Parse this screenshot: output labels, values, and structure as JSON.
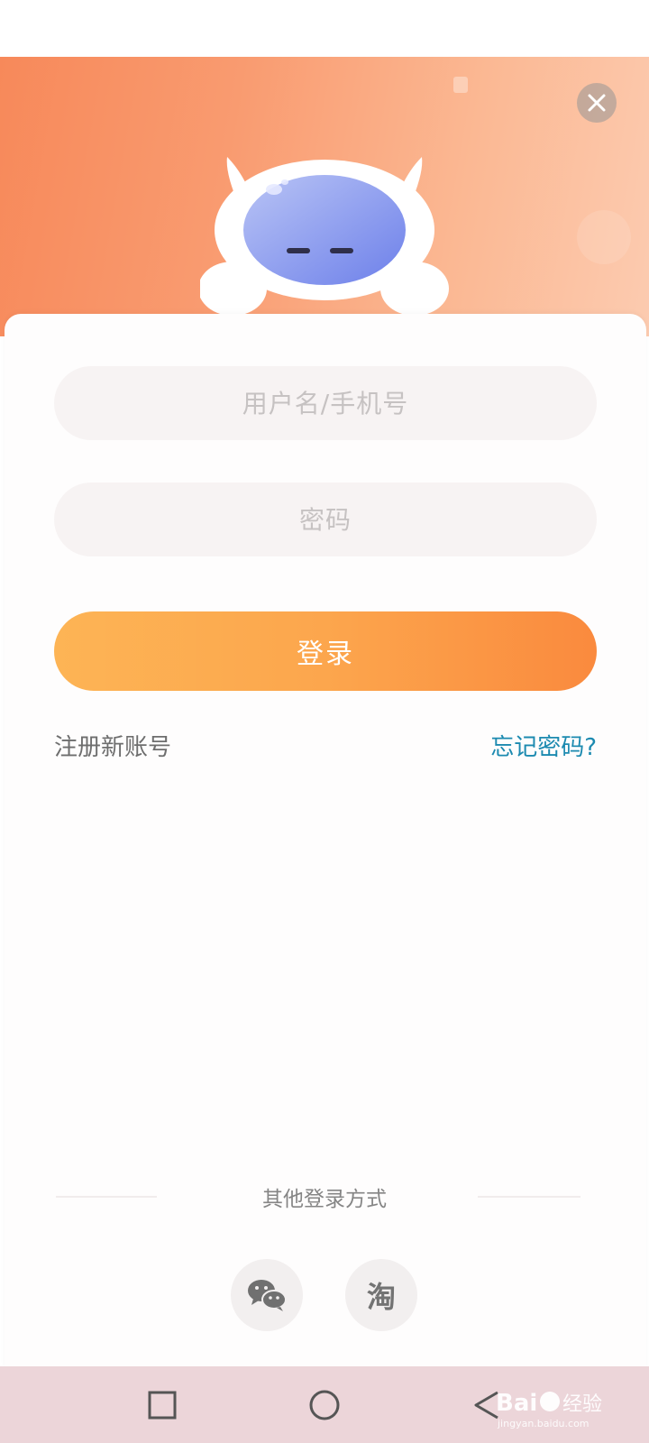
{
  "form": {
    "username_placeholder": "用户名/手机号",
    "password_placeholder": "密码",
    "login_label": "登录",
    "register_label": "注册新账号",
    "forgot_label": "忘记密码?"
  },
  "other_login": {
    "label": "其他登录方式",
    "providers": [
      {
        "name": "wechat",
        "icon": "wechat-icon"
      },
      {
        "name": "taobao",
        "icon": "taobao-icon",
        "glyph": "淘"
      }
    ]
  },
  "system_nav": {
    "buttons": [
      "recents",
      "home",
      "back"
    ]
  },
  "colors": {
    "accent_orange": "#fa8a3e",
    "link_blue": "#1c8ab0",
    "hero_gradient_start": "#f7895a"
  }
}
